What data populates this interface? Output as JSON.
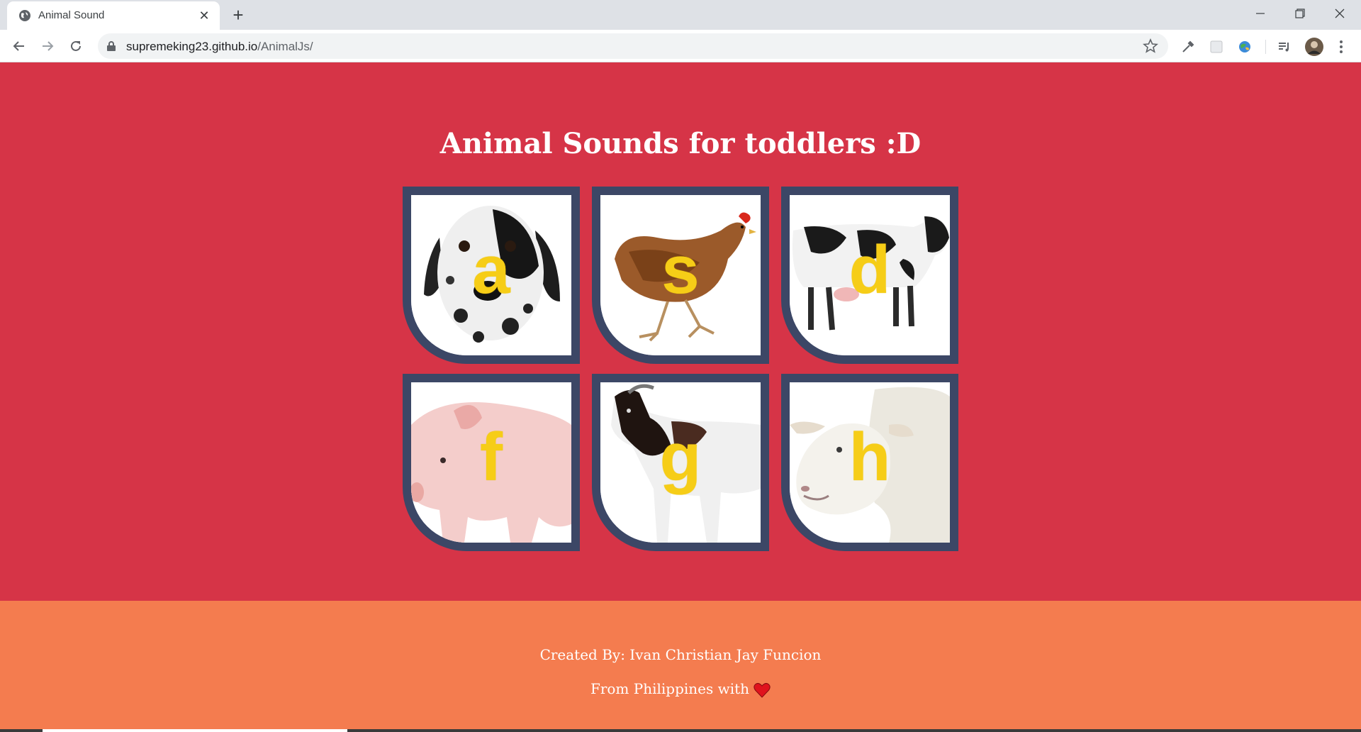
{
  "browser": {
    "tab_title": "Animal Sound",
    "url_host": "supremeking23.github.io",
    "url_path": "/AnimalJs/"
  },
  "page": {
    "title": "Animal Sounds for toddlers :D",
    "cards": [
      {
        "key": "a",
        "animal": "dog"
      },
      {
        "key": "s",
        "animal": "chicken"
      },
      {
        "key": "d",
        "animal": "cow"
      },
      {
        "key": "f",
        "animal": "pig"
      },
      {
        "key": "g",
        "animal": "goat"
      },
      {
        "key": "h",
        "animal": "sheep"
      }
    ]
  },
  "footer": {
    "credit": "Created By: Ivan Christian Jay Funcion",
    "origin": "From Philippines with"
  },
  "colors": {
    "background": "#d63447",
    "footer": "#f47c4f",
    "card_border": "#3c4766",
    "letter": "#f6cd17"
  }
}
